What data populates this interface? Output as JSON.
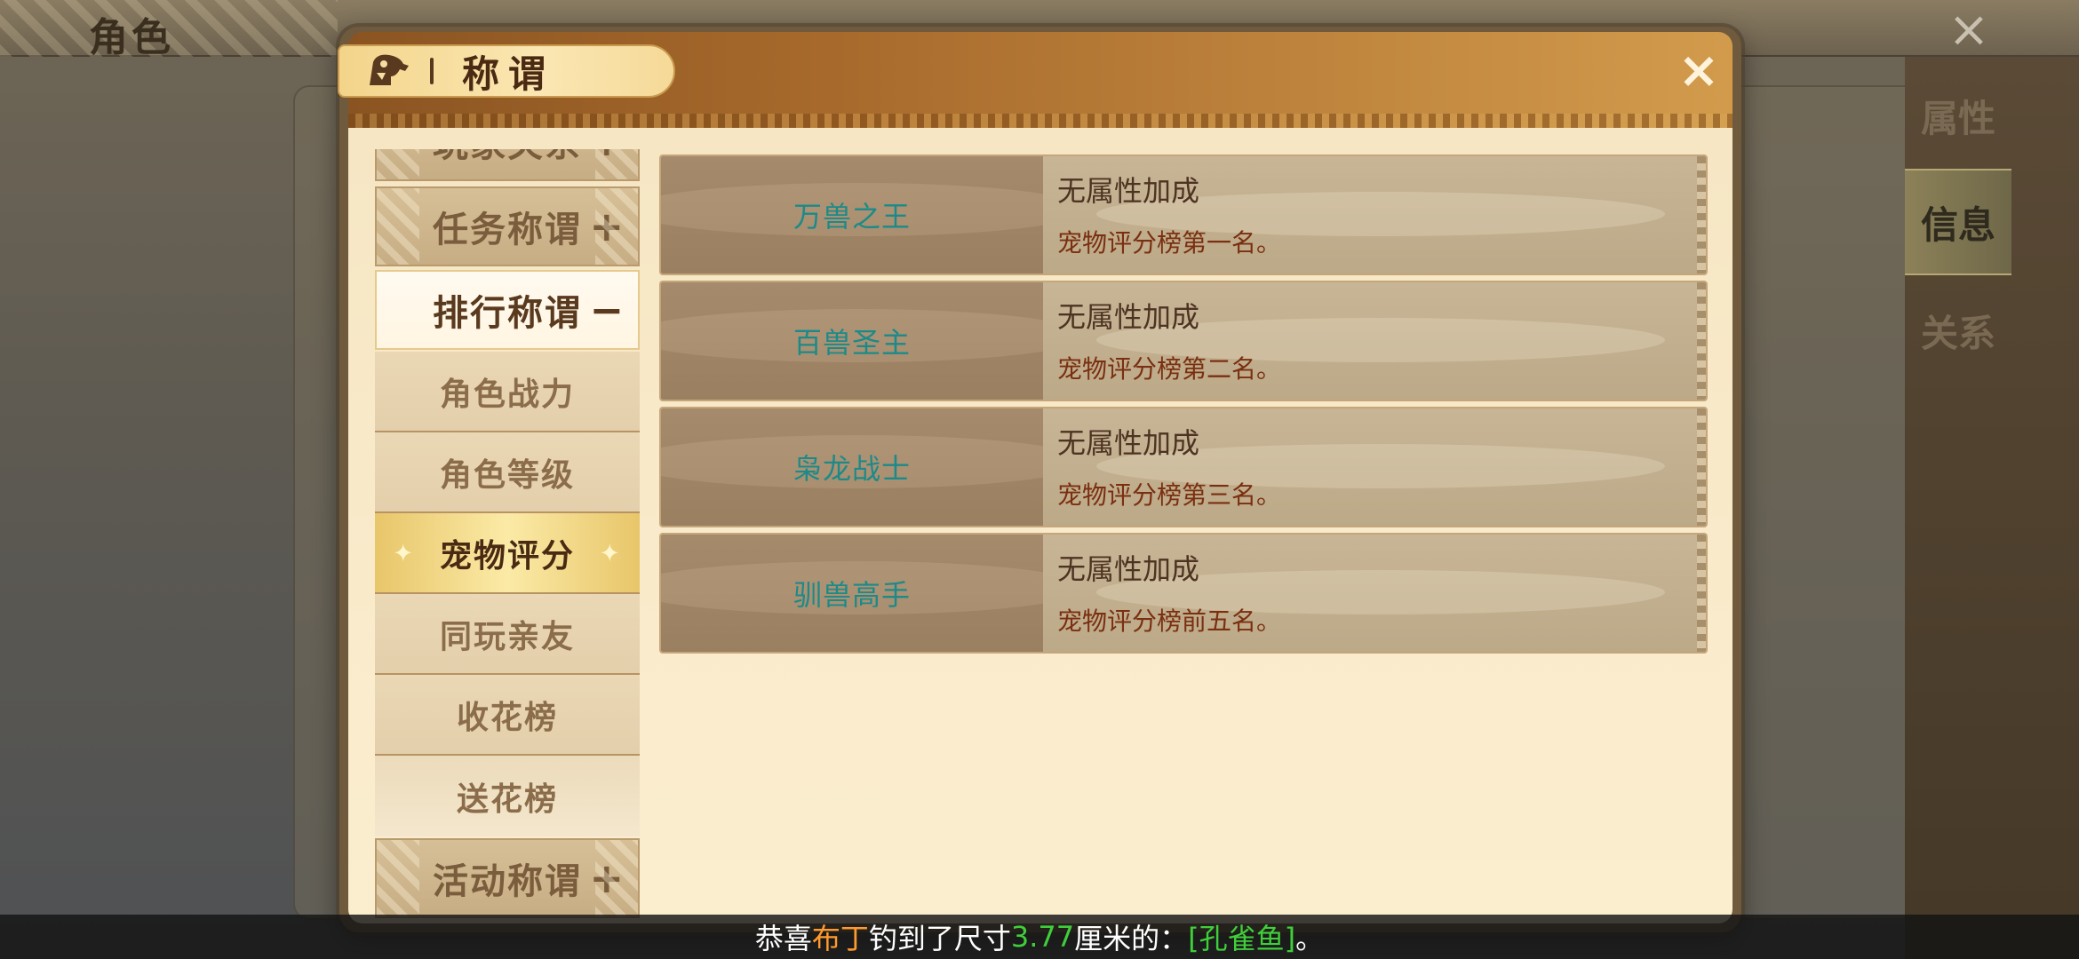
{
  "background": {
    "title": "角色",
    "close_icon": "×",
    "side_tabs": [
      {
        "label": "属性",
        "active": false
      },
      {
        "label": "信息",
        "active": true
      },
      {
        "label": "关系",
        "active": false
      }
    ]
  },
  "dialog": {
    "title": "称谓",
    "close_icon": "×"
  },
  "categories": {
    "partial_top": {
      "label": "玩家关系",
      "sign": "+"
    },
    "task": {
      "label": "任务称谓",
      "sign": "+"
    },
    "ranking": {
      "label": "排行称谓",
      "sign": "−"
    },
    "ranking_subs": [
      {
        "label": "角色战力"
      },
      {
        "label": "角色等级"
      },
      {
        "label": "宠物评分",
        "selected": true
      },
      {
        "label": "同玩亲友"
      },
      {
        "label": "收花榜"
      },
      {
        "label": "送花榜"
      }
    ],
    "activity": {
      "label": "活动称谓",
      "sign": "+"
    }
  },
  "titles": [
    {
      "name": "万兽之王",
      "bonus": "无属性加成",
      "condition": "宠物评分榜第一名。"
    },
    {
      "name": "百兽圣主",
      "bonus": "无属性加成",
      "condition": "宠物评分榜第二名。"
    },
    {
      "name": "枭龙战士",
      "bonus": "无属性加成",
      "condition": "宠物评分榜第三名。"
    },
    {
      "name": "驯兽高手",
      "bonus": "无属性加成",
      "condition": "宠物评分榜前五名。"
    }
  ],
  "marquee": {
    "prefix": "恭喜",
    "player": "布丁",
    "middle": "钓到了尺寸",
    "size": "3.77",
    "unit": "厘米的：",
    "item": "[孔雀鱼]",
    "suffix": "。"
  },
  "colors": {
    "title_name": "#1c8a8a",
    "condition": "#7a2f10",
    "marquee_player": "#ff9a2e",
    "marquee_green": "#3fcf3a"
  }
}
